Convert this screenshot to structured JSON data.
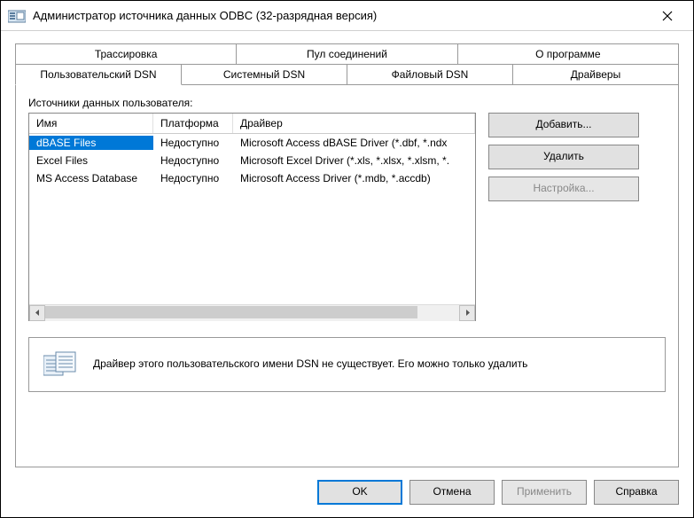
{
  "title": "Администратор источника данных ODBC (32-разрядная версия)",
  "tabs_row1": [
    "Трассировка",
    "Пул соединений",
    "О программе"
  ],
  "tabs_row2": [
    "Пользовательский DSN",
    "Системный DSN",
    "Файловый DSN",
    "Драйверы"
  ],
  "active_tab": "Пользовательский DSN",
  "list_label": "Источники данных пользователя:",
  "columns": {
    "name": "Имя",
    "platform": "Платформа",
    "driver": "Драйвер"
  },
  "rows": [
    {
      "name": "dBASE Files",
      "platform": "Недоступно",
      "driver": "Microsoft Access dBASE Driver (*.dbf, *.ndx",
      "selected": true
    },
    {
      "name": "Excel Files",
      "platform": "Недоступно",
      "driver": "Microsoft Excel Driver (*.xls, *.xlsx, *.xlsm, *.",
      "selected": false
    },
    {
      "name": "MS Access Database",
      "platform": "Недоступно",
      "driver": "Microsoft Access Driver (*.mdb, *.accdb)",
      "selected": false
    }
  ],
  "side": {
    "add": "Добавить...",
    "remove": "Удалить",
    "configure": "Настройка..."
  },
  "info_text": "Драйвер этого пользовательского имени DSN не существует. Его можно только удалить",
  "buttons": {
    "ok": "OK",
    "cancel": "Отмена",
    "apply": "Применить",
    "help": "Справка"
  }
}
